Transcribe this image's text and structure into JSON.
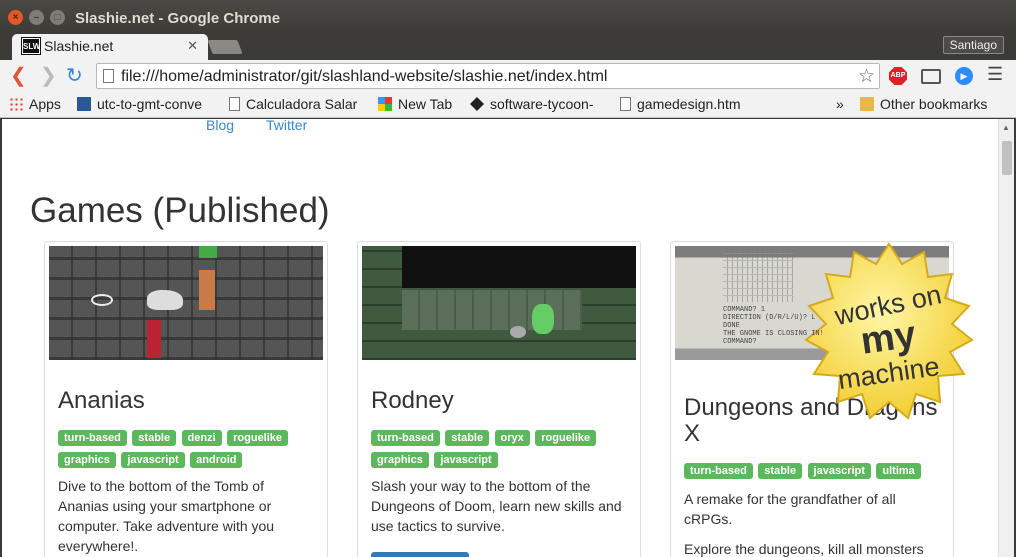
{
  "window": {
    "title": "Slashie.net - Google Chrome"
  },
  "tab": {
    "favicon_text": "SLW",
    "label": "Slashie.net",
    "close": "✕"
  },
  "profile": {
    "name": "Santiago"
  },
  "toolbar": {
    "url": "file:///home/administrator/git/slashland-website/slashie.net/index.html",
    "abp_label": "ABP"
  },
  "bookmarks": {
    "items": [
      "Apps",
      "utc-to-gmt-conve",
      "Calculadora Salar",
      "New Tab",
      "software-tycoon-",
      "gamedesign.htm"
    ],
    "overflow": "»",
    "other": "Other bookmarks"
  },
  "page": {
    "top_links": [
      "Blog",
      "Twitter"
    ],
    "heading": "Games (Published)",
    "badge": {
      "line1": "works on",
      "line2": "my",
      "line3": "machine"
    },
    "games": [
      {
        "title": "Ananias",
        "tags": [
          "turn-based",
          "stable",
          "denzi",
          "roguelike",
          "graphics",
          "javascript",
          "android"
        ],
        "description": "Dive to the bottom of the Tomb of Ananias using your smartphone or computer. Take adventure with you everywhere!."
      },
      {
        "title": "Rodney",
        "tags": [
          "turn-based",
          "stable",
          "oryx",
          "roguelike",
          "graphics",
          "javascript"
        ],
        "description": "Slash your way to the bottom of the Dungeons of Doom, learn new skills and use tactics to survive."
      },
      {
        "title": "Dungeons and Dragons X",
        "tags": [
          "turn-based",
          "stable",
          "javascript",
          "ultima"
        ],
        "description": "A remake for the grandfather of all cRPGs.",
        "description2": "Explore the dungeons, kill all monsters",
        "terminal_lines": [
          "COMMAND? 1",
          "DIRECTION (D/R/L/U)? L",
          "DONE",
          "THE GNOME IS CLOSING IN!",
          "COMMAND?"
        ]
      }
    ]
  }
}
